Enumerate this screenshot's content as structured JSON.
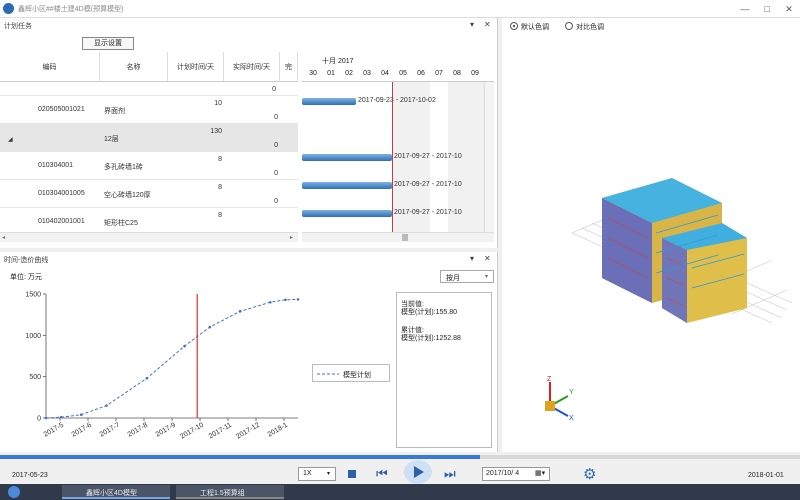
{
  "window": {
    "title": "鑫辉小区##楼土建4D模(预算模型)"
  },
  "task_panel": {
    "title": "计划任务",
    "display_settings_label": "显示设置",
    "columns": [
      "编码",
      "名称",
      "计划时间/天",
      "实际时间/天",
      "完"
    ],
    "rows": [
      {
        "code": "",
        "name": "",
        "plan": "",
        "actual": "0",
        "expander": ""
      },
      {
        "code": "020505001021",
        "name": "界面剂",
        "plan": "10",
        "actual": "0",
        "expander": ""
      },
      {
        "code": "",
        "name": "12层",
        "plan": "130",
        "actual": "0",
        "expander": "◢"
      },
      {
        "code": "010304001",
        "name": "多孔砖墙1砖",
        "plan": "8",
        "actual": "0",
        "expander": ""
      },
      {
        "code": "010304001005",
        "name": "空心砖墙120厚",
        "plan": "8",
        "actual": "0",
        "expander": ""
      },
      {
        "code": "010402001001",
        "name": "矩形柱C25",
        "plan": "8",
        "actual": "",
        "expander": ""
      }
    ],
    "gantt_month": "十月 2017",
    "gantt_days": [
      "30",
      "01",
      "02",
      "03",
      "04",
      "05",
      "06",
      "07",
      "08",
      "09"
    ],
    "gantt_bars": [
      {
        "label": "2017-09-23 - 2017-10-02"
      },
      {
        "label": "2017-09-27 - 2017-10"
      },
      {
        "label": "2017-09-27 - 2017-10"
      },
      {
        "label": "2017-09-27 - 2017-10"
      }
    ]
  },
  "curve_panel": {
    "title": "时间-造价曲线",
    "unit_label": "单位: 万元",
    "period_select": "按月",
    "legend_label": "模型计划",
    "current_label": "当前值:",
    "current_value": "模型(计划):155.80",
    "cumulative_label": "累计值:",
    "cumulative_value": "模型(计划):1252.88"
  },
  "chart_data": {
    "type": "line",
    "title": "",
    "xlabel": "",
    "ylabel": "",
    "ylim": [
      0,
      1500
    ],
    "yticks": [
      0,
      500,
      1000,
      1500
    ],
    "categories": [
      "2017-5",
      "2017-6",
      "2017-7",
      "2017-8",
      "2017-9",
      "2017-10",
      "2017-11",
      "2017-12",
      "2018-1"
    ],
    "series": [
      {
        "name": "模型计划",
        "color": "#4a6fc0",
        "values": [
          0,
          10,
          40,
          150,
          480,
          870,
          1100,
          1290,
          1400,
          1430,
          1435
        ]
      }
    ],
    "x_fraction_points": [
      0,
      0.06,
      0.14,
      0.24,
      0.4,
      0.55,
      0.65,
      0.77,
      0.89,
      0.95,
      1.0
    ],
    "current_marker_fraction": 0.6,
    "grid": false
  },
  "model_panel": {
    "radio_default": "默认色调",
    "radio_compare": "对比色调",
    "axis_z": "Z",
    "axis_y": "Y",
    "axis_x": "X"
  },
  "playback": {
    "start_date": "2017-05-23",
    "end_date": "2018-01-01",
    "speed": "1X",
    "current_date": "2017/10/ 4",
    "progress": 0.6
  },
  "taskbar": {
    "items": [
      "鑫辉小区4D模型",
      "工程1.5预算组"
    ]
  },
  "colors": {
    "accent": "#2f6fb0",
    "today_line": "#e03030",
    "timeline": "#3a79d9"
  }
}
